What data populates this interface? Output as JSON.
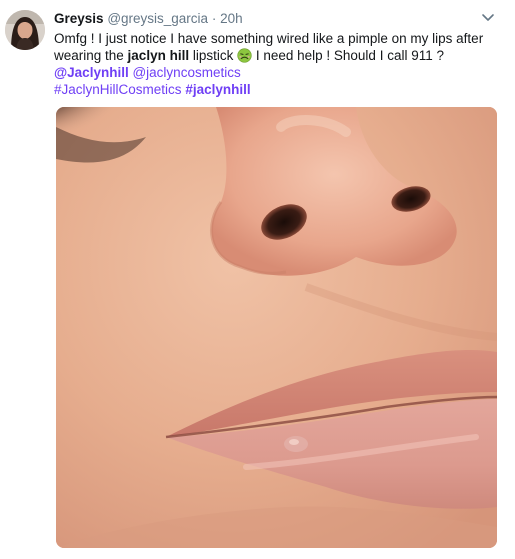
{
  "tweet": {
    "display_name": "Greysis",
    "handle": "@greysis_garcia",
    "separator": "·",
    "time": "20h",
    "text_line1": "Omfg ! I just notice I have something wired like a  pimple on my lips after",
    "text_line2_prefix": "wearing the ",
    "text_line2_bold": "jaclyn hill",
    "text_line2_mid": " lipstick ",
    "emoji": "nauseated-face-emoji",
    "text_line2_suffix": " I need help ! Should I call 911 ?",
    "mentions": [
      "@Jaclynhill",
      "@jaclyncosmetics"
    ],
    "hashtags": [
      "#JaclynHillCosmetics",
      "#jaclynhill"
    ]
  },
  "icons": {
    "avatar": "user-avatar",
    "menu": "chevron-down-icon"
  },
  "colors": {
    "link": "#6f3ff5",
    "text": "#14171a",
    "muted": "#657786"
  }
}
